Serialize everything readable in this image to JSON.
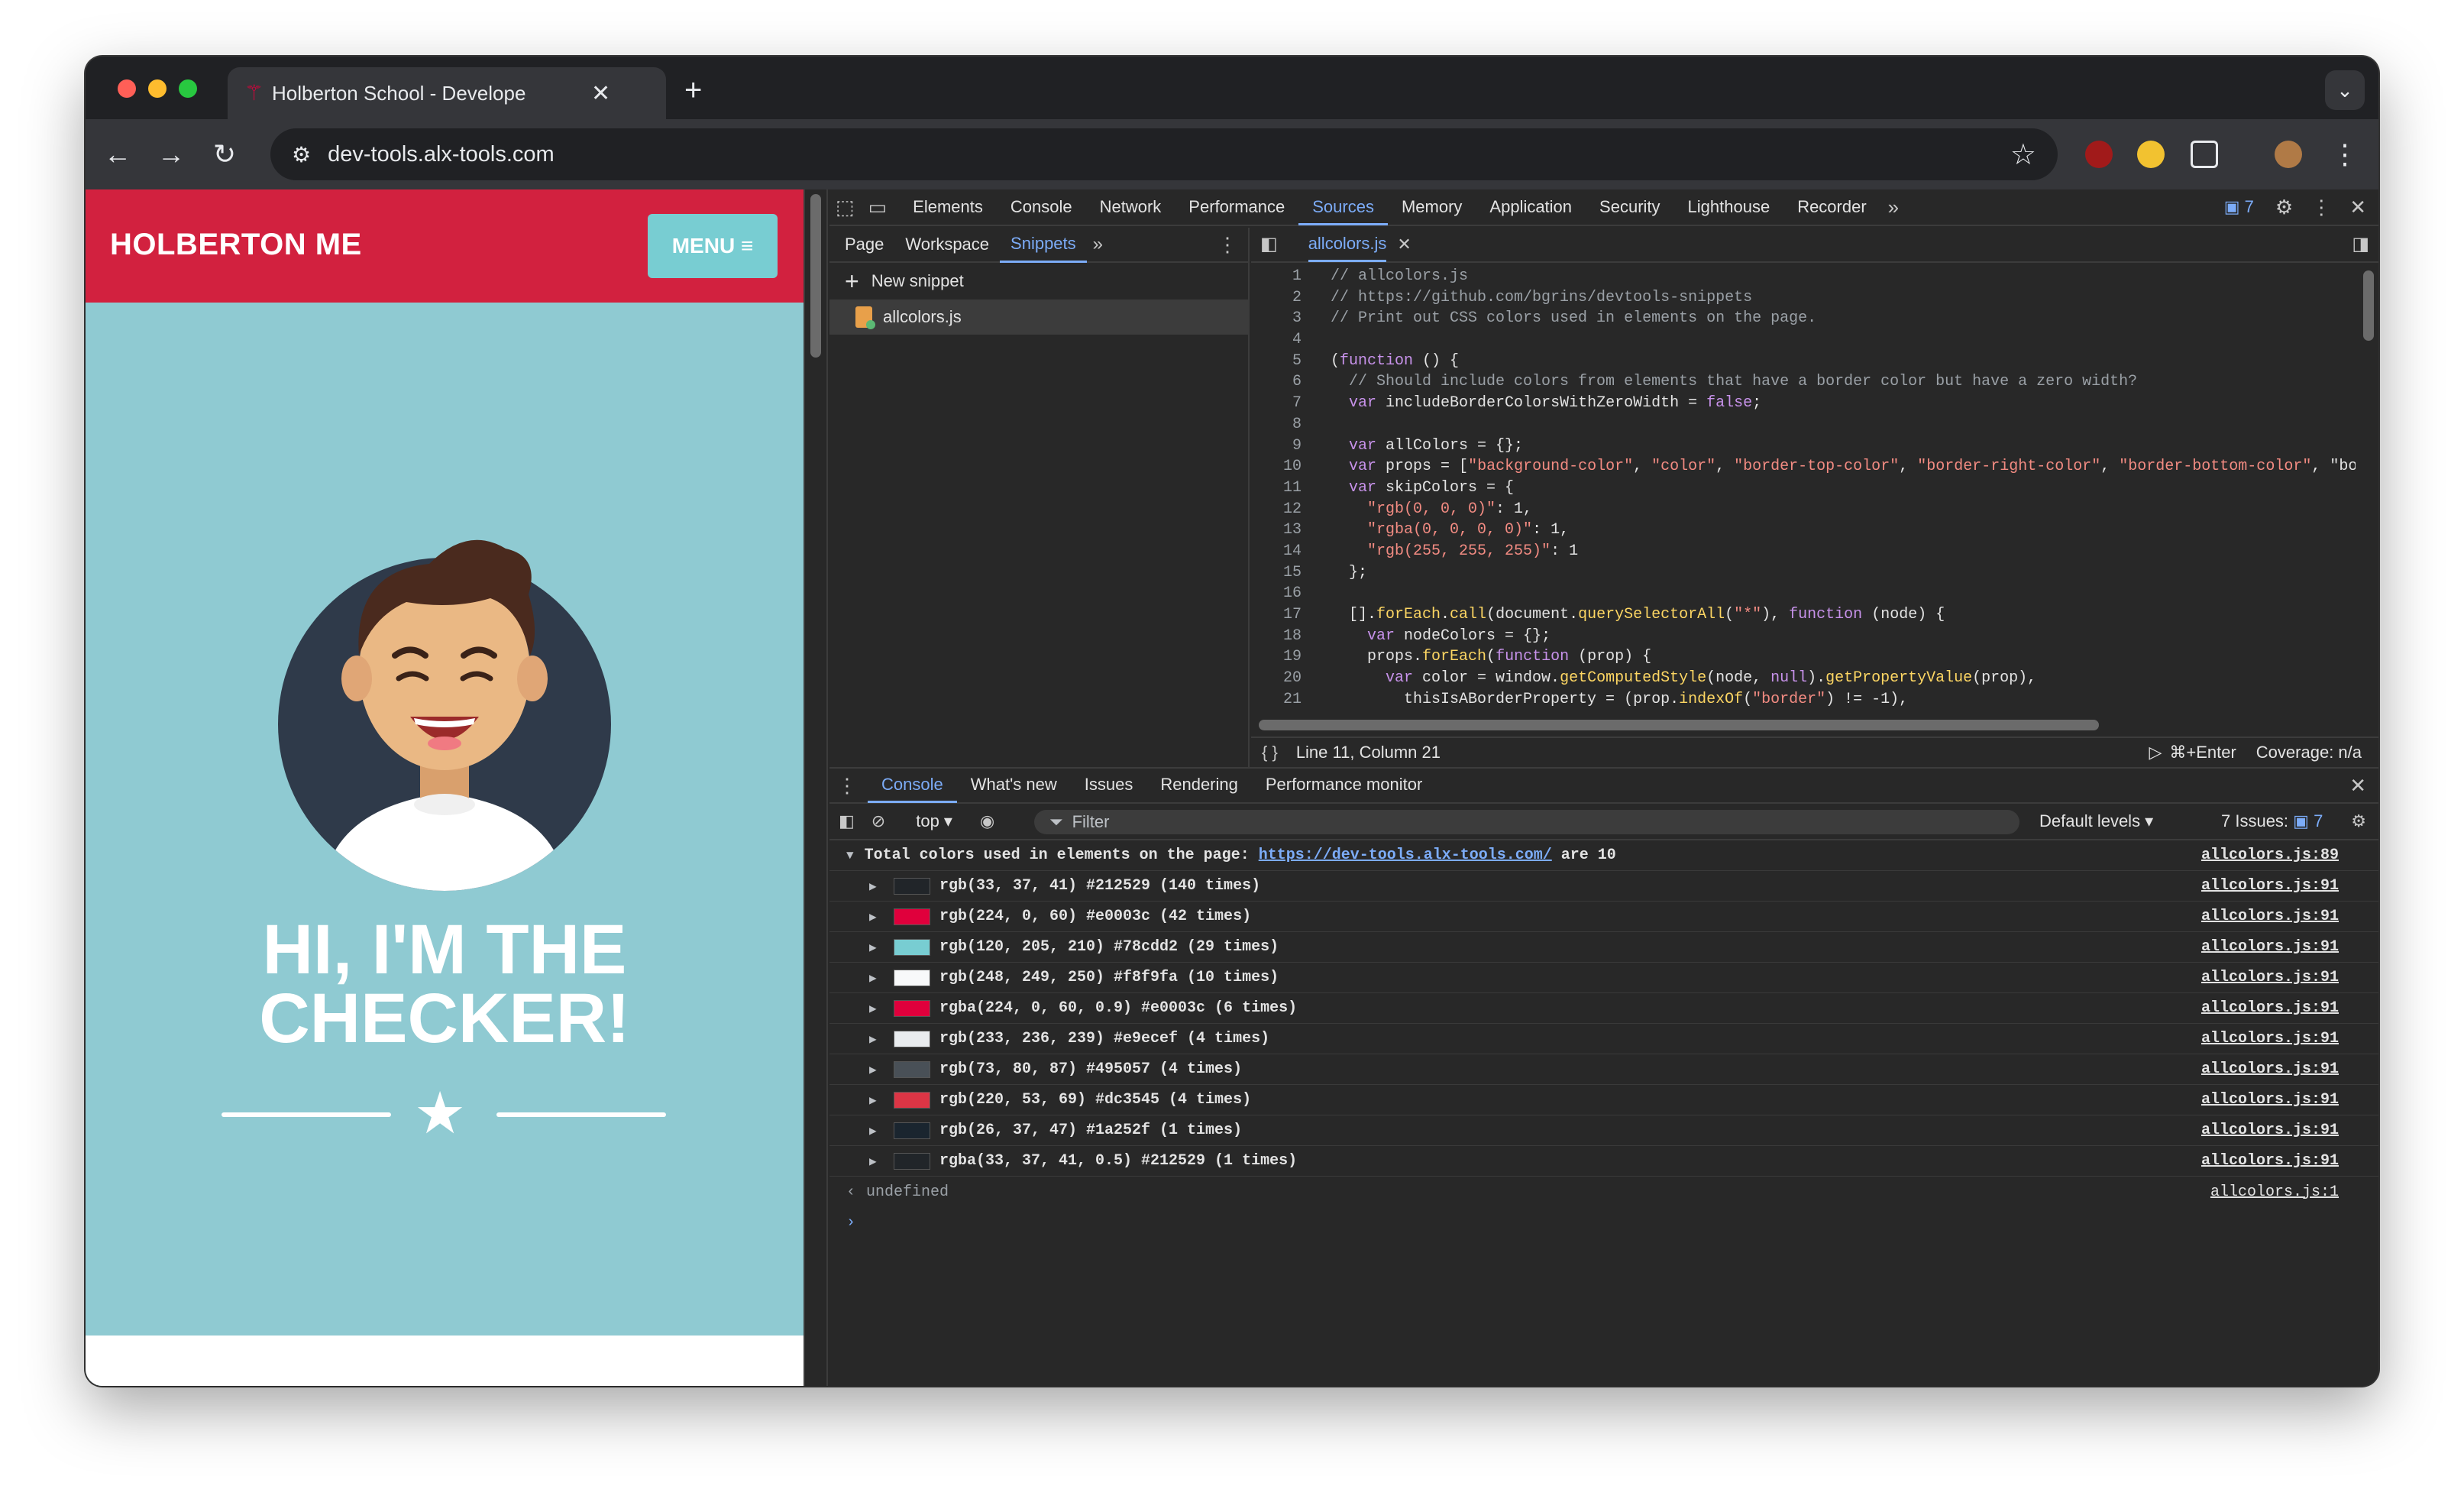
{
  "browser": {
    "tab_title": "Holberton School - Develope",
    "url": "dev-tools.alx-tools.com"
  },
  "page": {
    "brand": "HOLBERTON ME",
    "menu_label": "MENU ≡",
    "headline_line1": "HI, I'M THE",
    "headline_line2": "CHECKER!"
  },
  "devtools": {
    "tabs": [
      "Elements",
      "Console",
      "Network",
      "Performance",
      "Sources",
      "Memory",
      "Application",
      "Security",
      "Lighthouse",
      "Recorder"
    ],
    "active_tab": "Sources",
    "issues_badge": "7",
    "navigator_tabs": [
      "Page",
      "Workspace",
      "Snippets"
    ],
    "active_navigator_tab": "Snippets",
    "new_snippet_label": "New snippet",
    "snippet_file": "allcolors.js",
    "editor_tab": "allcolors.js",
    "status_position": "Line 11, Column 21",
    "run_shortcut": "⌘+Enter",
    "coverage": "Coverage: n/a",
    "code_lines": [
      "// allcolors.js",
      "// https://github.com/bgrins/devtools-snippets",
      "// Print out CSS colors used in elements on the page.",
      "",
      "(function () {",
      "  // Should include colors from elements that have a border color but have a zero width?",
      "  var includeBorderColorsWithZeroWidth = false;",
      "",
      "  var allColors = {};",
      "  var props = [\"background-color\", \"color\", \"border-top-color\", \"border-right-color\", \"border-bottom-color\", \"bor",
      "  var skipColors = {",
      "    \"rgb(0, 0, 0)\": 1,",
      "    \"rgba(0, 0, 0, 0)\": 1,",
      "    \"rgb(255, 255, 255)\": 1",
      "  };",
      "",
      "  [].forEach.call(document.querySelectorAll(\"*\"), function (node) {",
      "    var nodeColors = {};",
      "    props.forEach(function (prop) {",
      "      var color = window.getComputedStyle(node, null).getPropertyValue(prop),",
      "        thisIsABorderProperty = (prop.indexOf(\"border\") != -1),"
    ],
    "drawer_tabs": [
      "Console",
      "What's new",
      "Issues",
      "Rendering",
      "Performance monitor"
    ],
    "active_drawer_tab": "Console",
    "console_context": "top ▾",
    "filter_placeholder": "Filter",
    "default_levels": "Default levels ▾",
    "issues_count": "7 Issues:",
    "issues_count_badge": "7",
    "log_header_prefix": "Total colors used in elements on the page: ",
    "log_header_link": "https://dev-tools.alx-tools.com/",
    "log_header_suffix": " are 10",
    "log_header_source": "allcolors.js:89",
    "log_rows": [
      {
        "text": "rgb(33, 37, 41) #212529 (140 times)",
        "color": "#212529",
        "source": "allcolors.js:91"
      },
      {
        "text": "rgb(224, 0, 60) #e0003c (42 times)",
        "color": "#e0003c",
        "source": "allcolors.js:91"
      },
      {
        "text": "rgb(120, 205, 210) #78cdd2 (29 times)",
        "color": "#78cdd2",
        "source": "allcolors.js:91"
      },
      {
        "text": "rgb(248, 249, 250) #f8f9fa (10 times)",
        "color": "#f8f9fa",
        "source": "allcolors.js:91"
      },
      {
        "text": "rgba(224, 0, 60, 0.9) #e0003c (6 times)",
        "color": "#e0003c",
        "source": "allcolors.js:91"
      },
      {
        "text": "rgb(233, 236, 239) #e9ecef (4 times)",
        "color": "#e9ecef",
        "source": "allcolors.js:91"
      },
      {
        "text": "rgb(73, 80, 87) #495057 (4 times)",
        "color": "#495057",
        "source": "allcolors.js:91"
      },
      {
        "text": "rgb(220, 53, 69) #dc3545 (4 times)",
        "color": "#dc3545",
        "source": "allcolors.js:91"
      },
      {
        "text": "rgb(26, 37, 47) #1a252f (1 times)",
        "color": "#1a252f",
        "source": "allcolors.js:91"
      },
      {
        "text": "rgba(33, 37, 41, 0.5) #212529 (1 times)",
        "color": "#212529",
        "source": "allcolors.js:91"
      }
    ],
    "return_value": "undefined",
    "return_source": "allcolors.js:1"
  },
  "colors": {
    "brand_red": "#d2213f",
    "page_bg": "#8fcad2",
    "accent_blue": "#7cacf8"
  }
}
